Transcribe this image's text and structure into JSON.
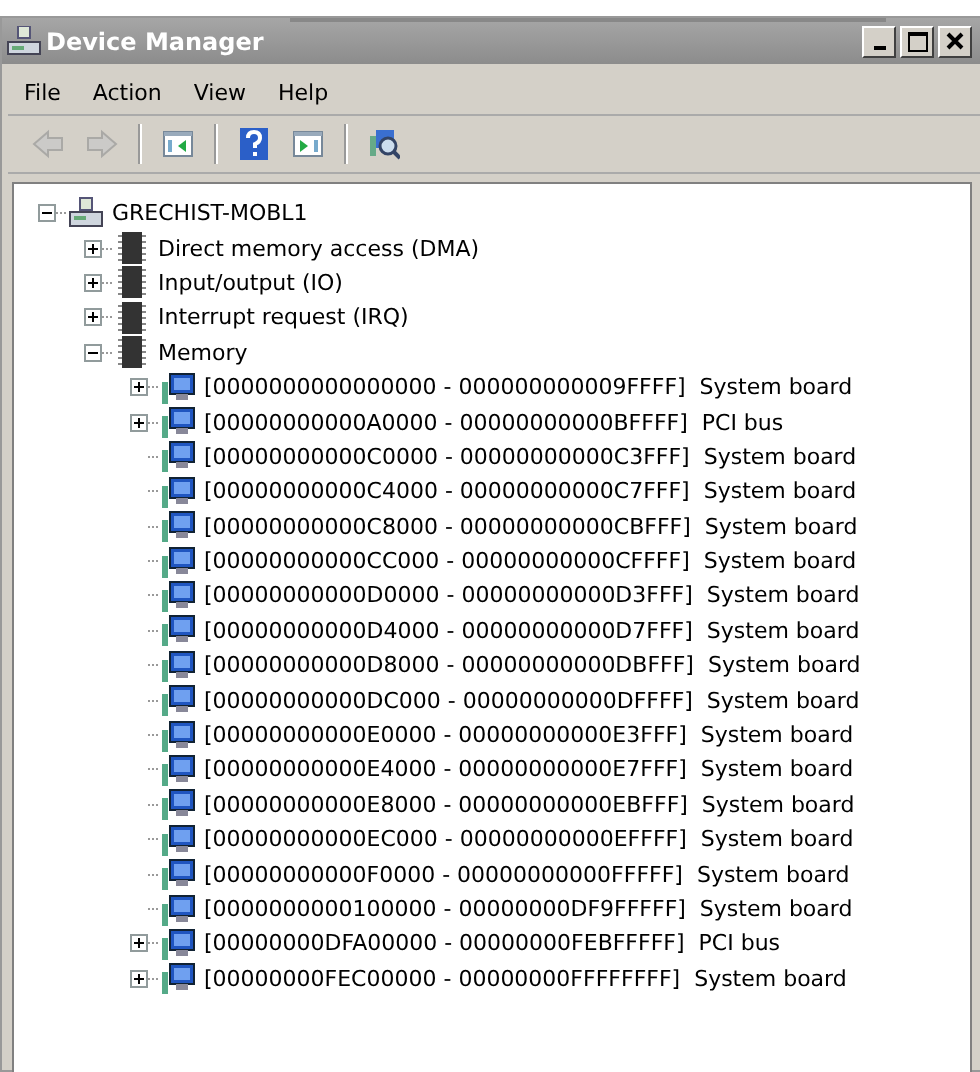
{
  "window": {
    "title": "Device Manager"
  },
  "menu": [
    "File",
    "Action",
    "View",
    "Help"
  ],
  "toolbar": [
    {
      "kind": "back",
      "disabled": true
    },
    {
      "kind": "forward",
      "disabled": true
    },
    {
      "kind": "separator"
    },
    {
      "kind": "console-tree"
    },
    {
      "kind": "separator"
    },
    {
      "kind": "help"
    },
    {
      "kind": "action-pane"
    },
    {
      "kind": "separator"
    },
    {
      "kind": "scan"
    }
  ],
  "tree": [
    {
      "label": "GRECHIST-MOBL1",
      "kind": "computer",
      "expanded": true,
      "children": [
        {
          "label": "Direct memory access (DMA)",
          "kind": "category",
          "expanded": false
        },
        {
          "label": "Input/output (IO)",
          "kind": "category",
          "expanded": false
        },
        {
          "label": "Interrupt request (IRQ)",
          "kind": "category",
          "expanded": false
        },
        {
          "label": "Memory",
          "kind": "category",
          "expanded": true,
          "children": [
            {
              "label": "[0000000000000000 - 000000000009FFFF]  System board",
              "kind": "device",
              "expanded": false
            },
            {
              "label": "[00000000000A0000 - 00000000000BFFFF]  PCI bus",
              "kind": "device",
              "expanded": false
            },
            {
              "label": "[00000000000C0000 - 00000000000C3FFF]  System board",
              "kind": "device"
            },
            {
              "label": "[00000000000C4000 - 00000000000C7FFF]  System board",
              "kind": "device"
            },
            {
              "label": "[00000000000C8000 - 00000000000CBFFF]  System board",
              "kind": "device"
            },
            {
              "label": "[00000000000CC000 - 00000000000CFFFF]  System board",
              "kind": "device"
            },
            {
              "label": "[00000000000D0000 - 00000000000D3FFF]  System board",
              "kind": "device"
            },
            {
              "label": "[00000000000D4000 - 00000000000D7FFF]  System board",
              "kind": "device"
            },
            {
              "label": "[00000000000D8000 - 00000000000DBFFF]  System board",
              "kind": "device"
            },
            {
              "label": "[00000000000DC000 - 00000000000DFFFF]  System board",
              "kind": "device"
            },
            {
              "label": "[00000000000E0000 - 00000000000E3FFF]  System board",
              "kind": "device"
            },
            {
              "label": "[00000000000E4000 - 00000000000E7FFF]  System board",
              "kind": "device"
            },
            {
              "label": "[00000000000E8000 - 00000000000EBFFF]  System board",
              "kind": "device"
            },
            {
              "label": "[00000000000EC000 - 00000000000EFFFF]  System board",
              "kind": "device"
            },
            {
              "label": "[00000000000F0000 - 00000000000FFFFF]  System board",
              "kind": "device"
            },
            {
              "label": "[0000000000100000 - 00000000DF9FFFFF]  System board",
              "kind": "device"
            },
            {
              "label": "[00000000DFA00000 - 00000000FEBFFFFF]  PCI bus",
              "kind": "device",
              "expanded": false
            },
            {
              "label": "[00000000FEC00000 - 00000000FFFFFFFF]  System board",
              "kind": "device",
              "expanded": false
            }
          ]
        }
      ]
    }
  ]
}
